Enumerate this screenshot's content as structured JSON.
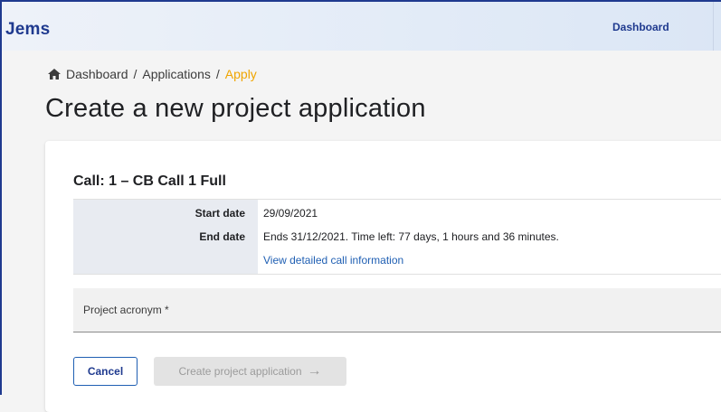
{
  "app": {
    "brand": "Jems"
  },
  "nav": {
    "dashboard": "Dashboard"
  },
  "breadcrumb": {
    "items": [
      "Dashboard",
      "Applications"
    ],
    "separator": "/",
    "current": "Apply"
  },
  "page": {
    "title": "Create a new project application"
  },
  "call": {
    "heading": "Call: 1 – CB Call 1 Full",
    "start_label": "Start date",
    "start_value": "29/09/2021",
    "end_label": "End date",
    "end_value": "Ends 31/12/2021. Time left: 77 days, 1 hours and 36 minutes.",
    "details_link": "View detailed call information"
  },
  "form": {
    "acronym_label": "Project acronym *"
  },
  "actions": {
    "cancel": "Cancel",
    "create": "Create project application"
  },
  "icons": {
    "home": "home-icon",
    "arrow": "arrow-right-icon"
  },
  "colors": {
    "brand": "#1f3a8f",
    "accent": "#f0a500",
    "link": "#1f5fb3"
  }
}
